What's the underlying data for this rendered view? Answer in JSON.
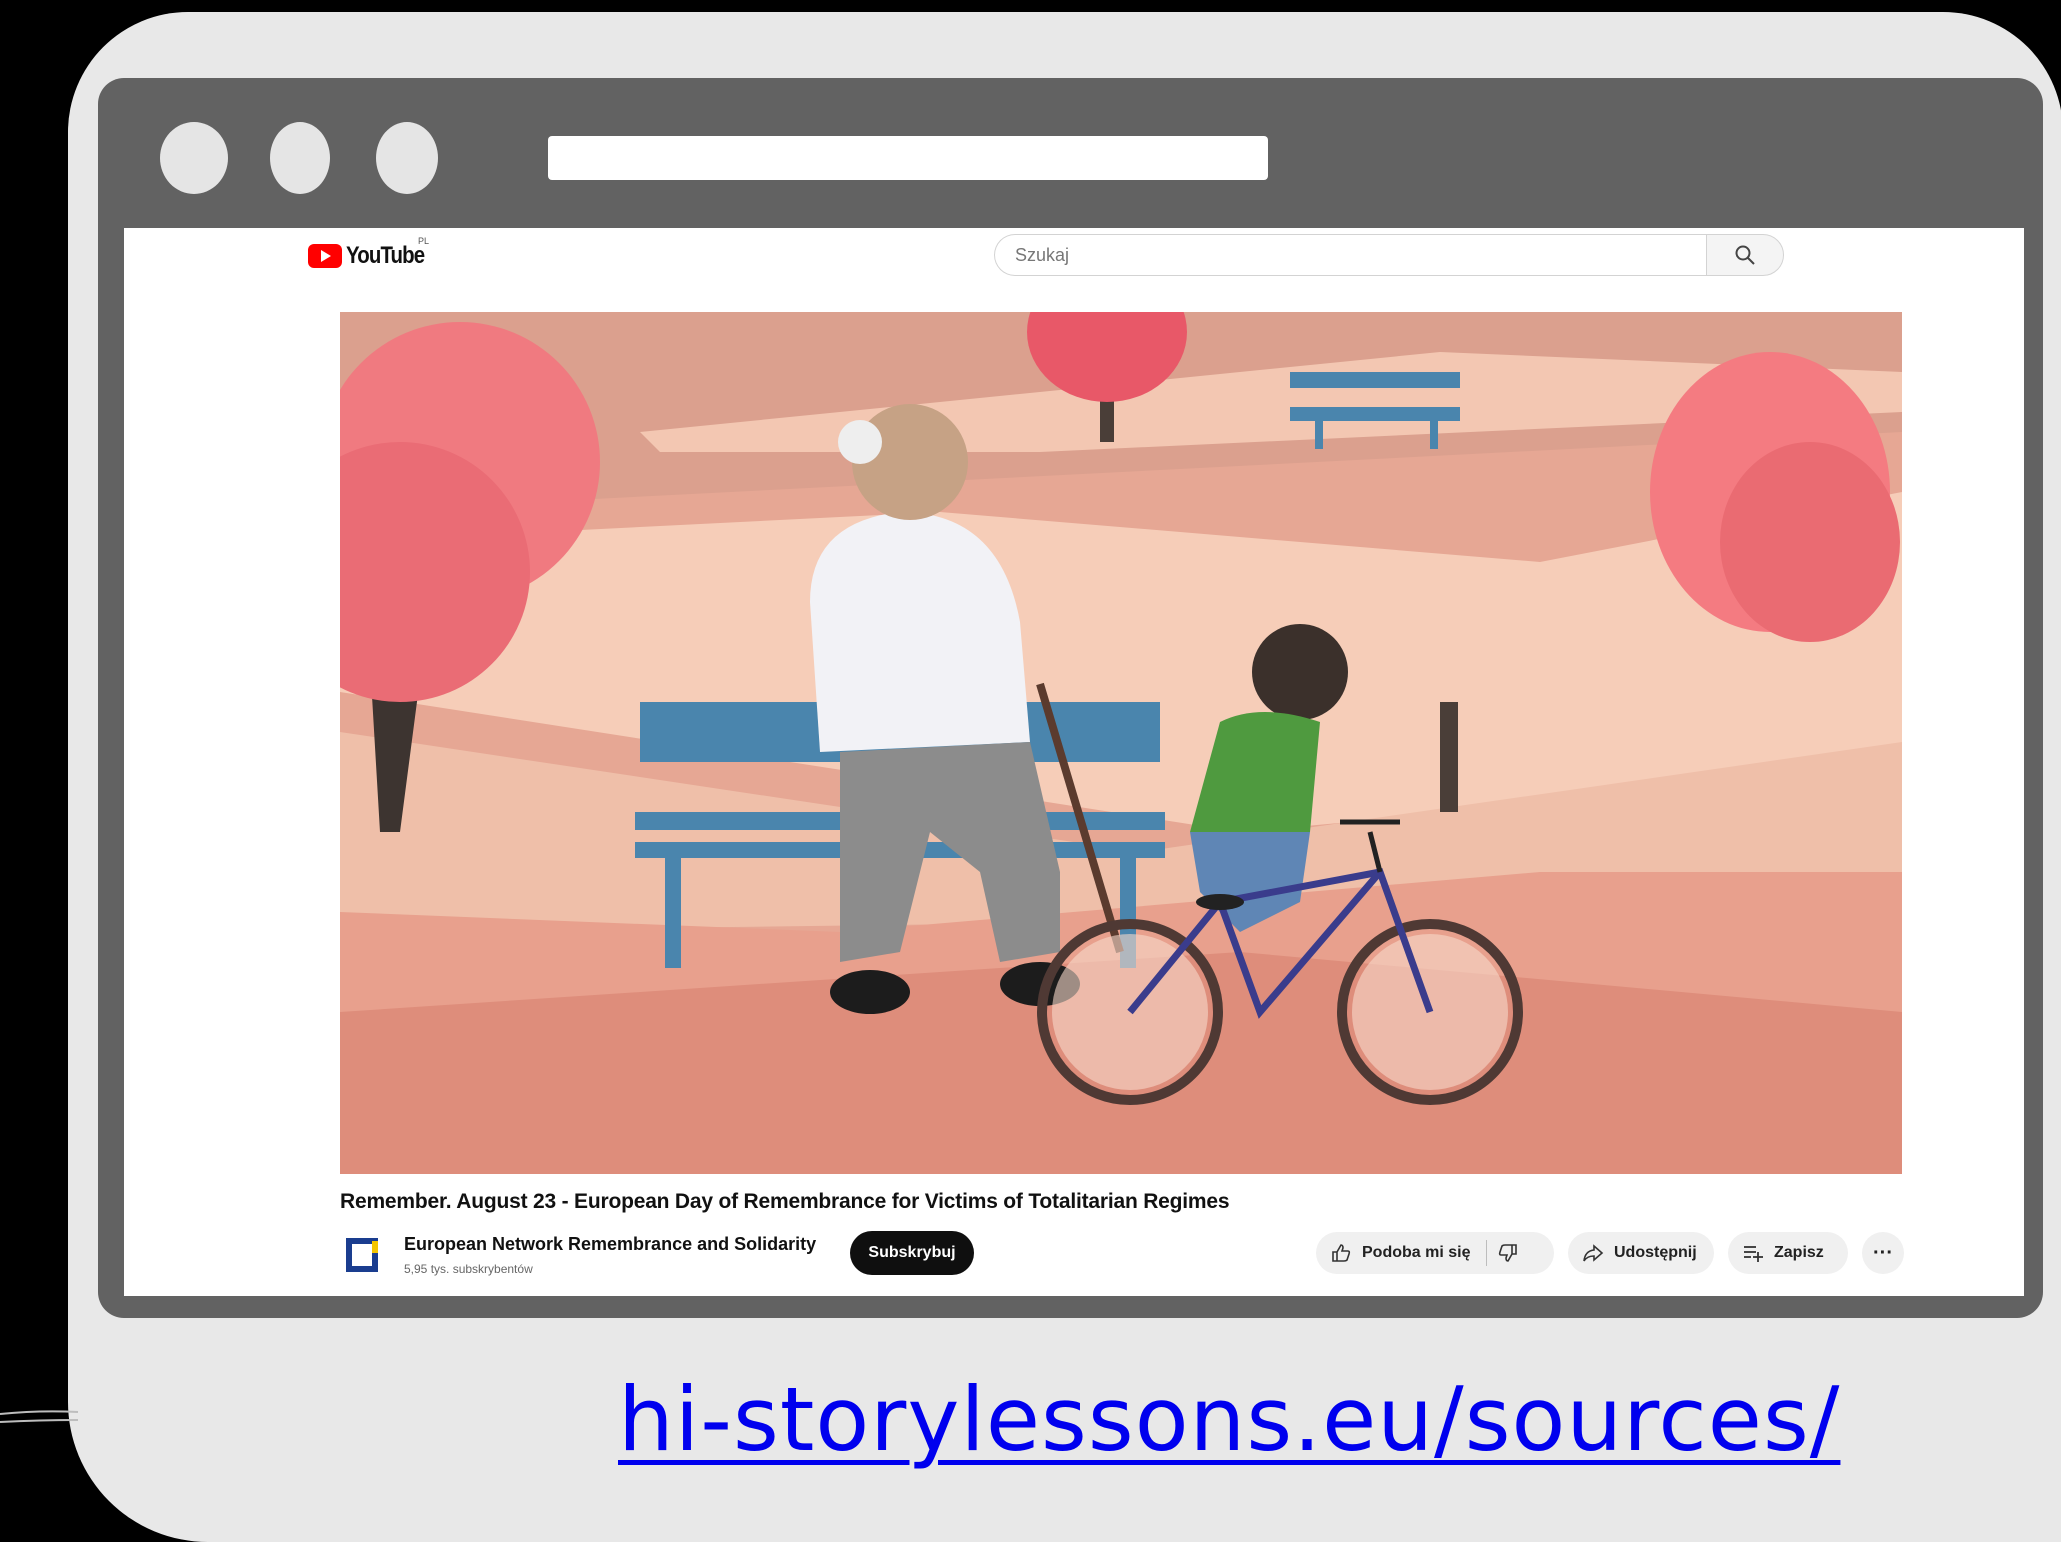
{
  "youtube": {
    "logo_text": "YouTube",
    "region": "PL",
    "search_placeholder": "Szukaj"
  },
  "video": {
    "title": "Remember. August 23 - European Day of Remembrance for Victims of Totalitarian Regimes"
  },
  "channel": {
    "name": "European Network Remembrance and Solidarity",
    "subscribers": "5,95 tys. subskrybentów",
    "subscribe_label": "Subskrybuj"
  },
  "actions": {
    "like_label": "Podoba mi się",
    "share_label": "Udostępnij",
    "save_label": "Zapisz",
    "more_label": "···"
  },
  "footer": {
    "link_text": "hi-storylessons.eu/sources/"
  },
  "colors": {
    "frame": "#626262",
    "card": "#e8e8e8",
    "youtube_red": "#ff0000",
    "link": "#0000ee"
  }
}
